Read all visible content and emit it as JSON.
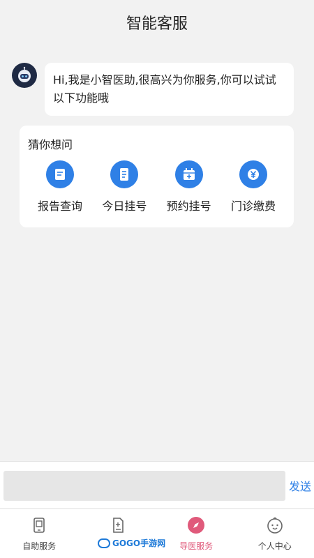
{
  "header": {
    "title": "智能客服"
  },
  "chat": {
    "bot_message": "Hi,我是小智医助,很高兴为你服务,你可以试试以下功能哦"
  },
  "suggest": {
    "title": "猜你想问",
    "items": [
      {
        "label": "报告查询",
        "icon": "report-doc-icon"
      },
      {
        "label": "今日挂号",
        "icon": "list-doc-icon"
      },
      {
        "label": "预约挂号",
        "icon": "calendar-plus-icon"
      },
      {
        "label": "门诊缴费",
        "icon": "yen-coin-icon"
      }
    ]
  },
  "input": {
    "placeholder": "",
    "send_label": "发送"
  },
  "tabbar": {
    "items": [
      {
        "label": "自助服务",
        "icon": "phone-device-icon",
        "active": false
      },
      {
        "label": "",
        "icon": "document-plus-icon",
        "active": false
      },
      {
        "label": "导医服务",
        "icon": "compass-icon",
        "active": true
      },
      {
        "label": "个人中心",
        "icon": "baby-face-icon",
        "active": false
      }
    ]
  },
  "watermark": {
    "text": "GOGO手游网"
  },
  "colors": {
    "accent": "#2f80e6",
    "active_tab": "#e05a7b"
  }
}
